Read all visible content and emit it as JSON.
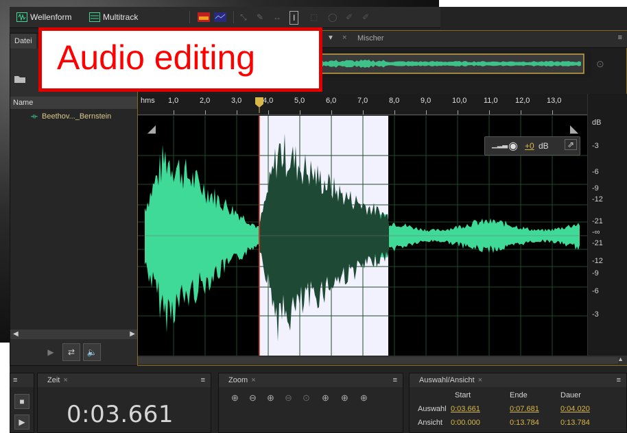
{
  "toolbar": {
    "waveform_label": "Wellenform",
    "multitrack_label": "Multitrack"
  },
  "files_panel": {
    "tab_label": "Datei",
    "name_header": "Name",
    "file_name": "Beethov..._Bernstein"
  },
  "editor": {
    "mixer_tab": "Mischer"
  },
  "ruler": {
    "unit": "hms",
    "labels": [
      "1,0",
      "2,0",
      "3,0",
      "4,0",
      "5,0",
      "6,0",
      "7,0",
      "8,0",
      "9,0",
      "10,0",
      "11,0",
      "12,0",
      "13,0"
    ]
  },
  "db_scale": {
    "unit": "dB",
    "labels": [
      "-3",
      "-6",
      "-9",
      "-12",
      "-21",
      "-∞",
      "-21",
      "-12",
      "-9",
      "-6",
      "-3"
    ]
  },
  "hud": {
    "gain": "+0",
    "unit": "dB"
  },
  "time_panel": {
    "title": "Zeit",
    "current_time": "0:03.661"
  },
  "zoom_panel": {
    "title": "Zoom"
  },
  "selection_panel": {
    "title": "Auswahl/Ansicht",
    "columns": [
      "Start",
      "Ende",
      "Dauer"
    ],
    "rows": [
      {
        "label": "Auswahl",
        "start": "0:03.661",
        "end": "0:07.681",
        "duration": "0:04.020"
      },
      {
        "label": "Ansicht",
        "start": "0:00.000",
        "end": "0:13.784",
        "duration": "0:13.784"
      }
    ]
  },
  "caption": {
    "text": "Audio editing"
  },
  "colors": {
    "waveform": "#3fd998",
    "waveform_selected": "#1e4a35",
    "selection_bg": "#f2f2ff",
    "playhead": "#e0402a",
    "accent": "#d9b84a"
  }
}
